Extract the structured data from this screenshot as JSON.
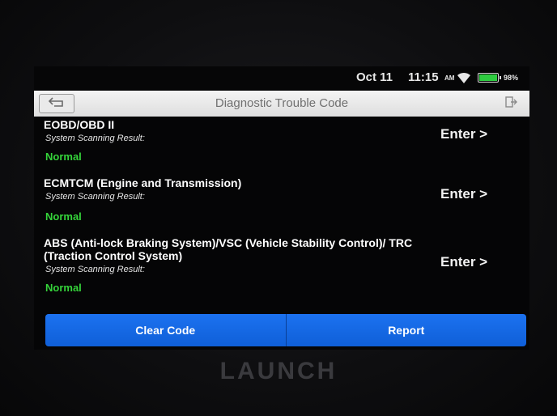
{
  "status_bar": {
    "date": "Oct 11",
    "time": "11:15",
    "ampm": "AM",
    "battery_percent": "98%",
    "battery_level": 0.98
  },
  "header": {
    "title": "Diagnostic Trouble Code"
  },
  "systems": [
    {
      "name": "EOBD/OBD II",
      "label": "System Scanning Result:",
      "status": "Normal",
      "action": "Enter >"
    },
    {
      "name": "ECMTCM (Engine and Transmission)",
      "label": "System Scanning Result:",
      "status": "Normal",
      "action": "Enter >"
    },
    {
      "name": "ABS (Anti-lock Braking System)/VSC (Vehicle Stability Control)/ TRC (Traction Control System)",
      "label": "System Scanning Result:",
      "status": "Normal",
      "action": "Enter >"
    }
  ],
  "footer_buttons": {
    "clear_code": "Clear Code",
    "report": "Report"
  },
  "brand": "LAUNCH",
  "colors": {
    "accent_blue": "#1c72f0",
    "status_green": "#35d43a"
  },
  "icons": {
    "back": "back-arrow-icon",
    "exit": "exit-icon",
    "wifi": "wifi-icon",
    "battery": "battery-icon"
  }
}
